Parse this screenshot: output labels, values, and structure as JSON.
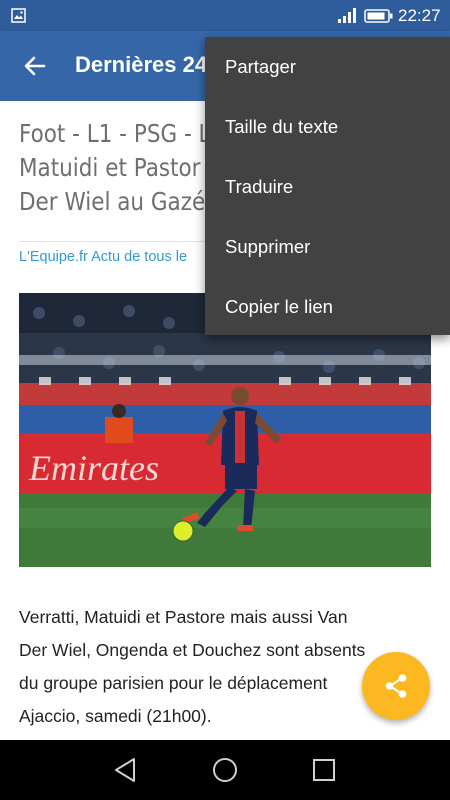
{
  "status_bar": {
    "time": "22:27",
    "left_icon": "image-notification-icon",
    "signal_icon": "signal-icon",
    "battery_icon": "battery-icon"
  },
  "app_bar": {
    "title": "Dernières 24",
    "back_icon": "arrow-left-icon",
    "color": "#3567a8"
  },
  "article": {
    "title_lines": [
      "Foot - L1 - PSG - L",
      "Matuidi et Pastor",
      "Der Wiel au Gazé"
    ],
    "source": "L'Equipe.fr Actu de tous le",
    "image_text": "Emirates",
    "body_lines": [
      "Verratti, Matuidi et Pastore mais aussi Van",
      "Der Wiel, Ongenda et Douchez sont absents",
      "du groupe parisien pour le déplacement",
      "Ajaccio, samedi (21h00)."
    ]
  },
  "menu": {
    "items": [
      "Partager",
      "Taille du texte",
      "Traduire",
      "Supprimer",
      "Copier le lien"
    ]
  },
  "fab": {
    "icon": "share-icon",
    "color": "#fbb820"
  },
  "nav_bar": {
    "back_icon": "nav-back-icon",
    "home_icon": "nav-home-icon",
    "recents_icon": "nav-recents-icon"
  }
}
